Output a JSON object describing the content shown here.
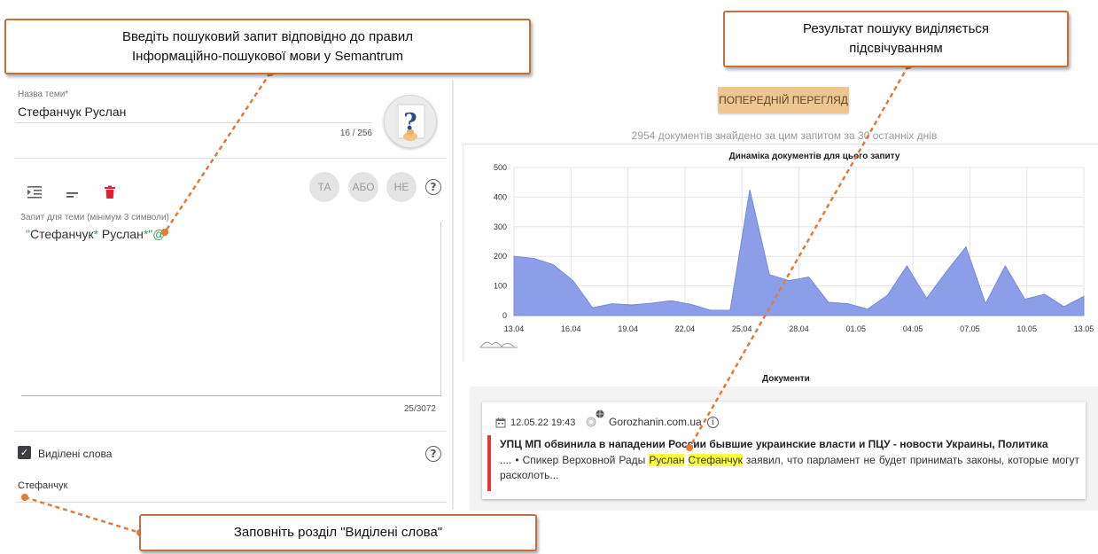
{
  "callouts": {
    "query_line1": "Введіть пошуковий запит відповідно до правил",
    "query_line2": "Інформаційно-пошукової  мови у Semantrum",
    "result_line1": "Результат пошуку виділяється",
    "result_line2": "підсвічуванням",
    "highlight": "Заповніть розділ \"Виділені слова\""
  },
  "form": {
    "topic_label": "Назва теми",
    "topic_required": "*",
    "topic_value": "Стефанчук Руслан",
    "topic_counter": "16 / 256",
    "query_label": "Запит для теми (мінімум 3 символи)",
    "query_counter": "25/3072",
    "query": {
      "q1": "\"",
      "t1": "Стефанчук",
      "q2": "*",
      "t2": " Руслан",
      "q3": "*\"@"
    },
    "operators": [
      "ТА",
      "АБО",
      "НЕ"
    ],
    "highlight_label": "Виділені слова",
    "highlight_checked": true,
    "highlight_value": "Стефанчук"
  },
  "icons": {
    "indent": "indent-icon",
    "format": "format-lines-icon",
    "delete": "trash-icon",
    "help": "question-circle-icon",
    "checkbox": "check-icon",
    "calendar": "calendar-icon",
    "source": "globe-gear-icon",
    "info": "info-icon"
  },
  "help_glyph": "?",
  "preview_button": "ПОПЕРЕДНІЙ ПЕРЕГЛЯД",
  "found_text": "2954 документів знайдено за цим запитом за 30 останніх днів",
  "chart_data": {
    "type": "area",
    "title": "Динаміка документів для цього запиту",
    "x_ticks": [
      "13.04",
      "16.04",
      "19.04",
      "22.04",
      "25.04",
      "28.04",
      "01.05",
      "04.05",
      "07.05",
      "10.05",
      "13.05"
    ],
    "y_ticks": [
      0,
      100,
      200,
      300,
      400,
      500
    ],
    "ylim": [
      0,
      500
    ],
    "values": [
      200,
      193,
      172,
      118,
      26,
      40,
      36,
      42,
      50,
      38,
      18,
      18,
      425,
      138,
      118,
      130,
      45,
      40,
      22,
      68,
      168,
      58,
      148,
      232,
      40,
      168,
      55,
      72,
      30,
      65
    ],
    "color": "#8c9ee8"
  },
  "documents": {
    "heading": "Документи",
    "items": [
      {
        "date": "12.05.22 19:43",
        "source": "Gorozhanin.com.ua",
        "info_glyph": "i",
        "title": "УПЦ МП обвинила в нападении России бывшие украинские власти и ПЦУ - новости Украины, Политика",
        "snippet_before": ".... • Спикер Верховной Рады ",
        "hl1": "Руслан",
        "hl2": "Стефанчук",
        "snippet_after": " заявил, что парламент не будет принимать законы, которые могут расколоть..."
      }
    ]
  },
  "colors": {
    "accent_button": "#efc68e",
    "callout_border": "#c4703c",
    "highlight": "#ffff3d",
    "delete_icon": "#e0202a",
    "query_green": "#34a853",
    "doc_marker": "#e23a3a"
  }
}
